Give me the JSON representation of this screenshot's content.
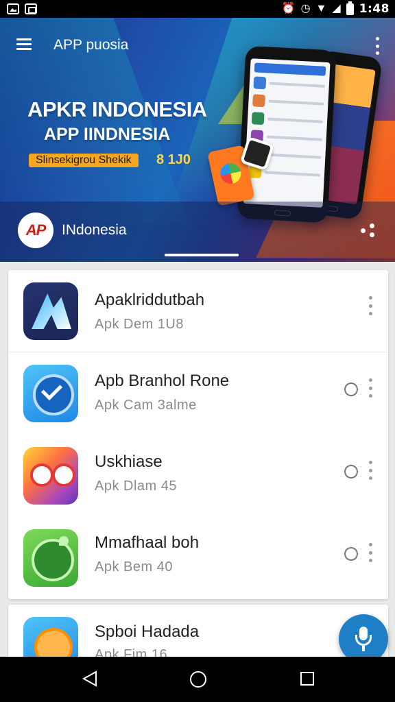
{
  "status_bar": {
    "time": "1:48",
    "icons": [
      "gallery-icon",
      "nfc-icon",
      "alarm-icon",
      "clock-icon",
      "wifi-icon",
      "signal-icon",
      "battery-icon"
    ]
  },
  "header": {
    "app_title": "APP puosia",
    "banner_title": "APKR INDONESIA",
    "banner_subtitle": "APP IINDNESIA",
    "banner_tag": "Slinsekigrou Shekik",
    "banner_tag2": "8 1J0",
    "region_logo": "AP",
    "region_label": "INdonesia",
    "colors": {
      "primary": "#1e4fa8",
      "accent_orange": "#ff7a1f",
      "logo_red": "#d0201b"
    }
  },
  "list": {
    "items": [
      {
        "title": "Apaklriddutbah",
        "subtitle": "Apk  Dem  1U8",
        "icon": "arrow-logo-icon",
        "has_radio": false
      },
      {
        "title": "Apb Branhol Rone",
        "subtitle": "Apk  Cam  3alme",
        "icon": "check-badge-icon",
        "has_radio": true
      },
      {
        "title": "Uskhiase",
        "subtitle": "Apk  Dlam  45",
        "icon": "glasses-face-icon",
        "has_radio": true
      },
      {
        "title": "Mmafhaal boh",
        "subtitle": "Apk  Bem  40",
        "icon": "chat-bubble-icon",
        "has_radio": true
      },
      {
        "title": "Spboi Hadada",
        "subtitle": "Apk  Fim  16",
        "icon": "sun-face-icon",
        "has_radio": false
      }
    ]
  },
  "fab": {
    "icon": "microphone-icon",
    "color": "#1f7fc6"
  },
  "nav_bar": {
    "icons": [
      "back-icon",
      "home-icon",
      "recents-icon"
    ]
  }
}
